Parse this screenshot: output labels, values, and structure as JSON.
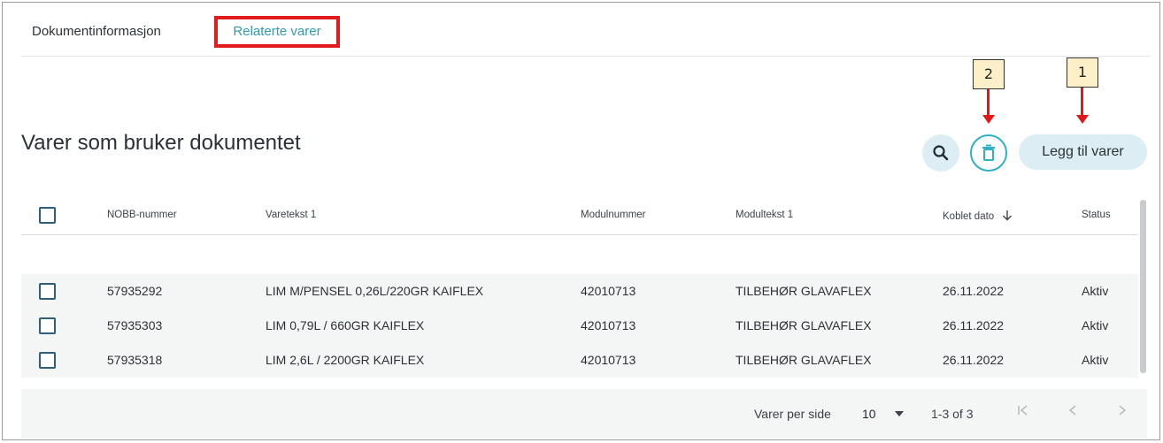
{
  "tabs": [
    {
      "label": "Dokumentinformasjon"
    },
    {
      "label": "Relaterte varer"
    }
  ],
  "callouts": {
    "one": "1",
    "two": "2"
  },
  "section": {
    "title": "Varer som bruker dokumentet"
  },
  "toolbar": {
    "add_label": "Legg til varer"
  },
  "table": {
    "headers": {
      "nobb": "NOBB-nummer",
      "varetekst": "Varetekst 1",
      "modulnummer": "Modulnummer",
      "modultekst": "Modultekst 1",
      "koblet": "Koblet dato",
      "status": "Status"
    },
    "rows": [
      {
        "nobb": "57935292",
        "varetekst": "LIM M/PENSEL 0,26L/220GR KAIFLEX",
        "modulnummer": "42010713",
        "modultekst": "TILBEHØR GLAVAFLEX",
        "koblet": "26.11.2022",
        "status": "Aktiv"
      },
      {
        "nobb": "57935303",
        "varetekst": "LIM 0,79L / 660GR KAIFLEX",
        "modulnummer": "42010713",
        "modultekst": "TILBEHØR GLAVAFLEX",
        "koblet": "26.11.2022",
        "status": "Aktiv"
      },
      {
        "nobb": "57935318",
        "varetekst": "LIM 2,6L / 2200GR KAIFLEX",
        "modulnummer": "42010713",
        "modultekst": "TILBEHØR GLAVAFLEX",
        "koblet": "26.11.2022",
        "status": "Aktiv"
      }
    ]
  },
  "pagination": {
    "per_page_label": "Varer per side",
    "per_page_value": "10",
    "range": "1-3 of 3"
  },
  "colors": {
    "accent": "#2eb0c6",
    "highlight": "#e01b1b",
    "callout_bg": "#fdf0c8"
  }
}
